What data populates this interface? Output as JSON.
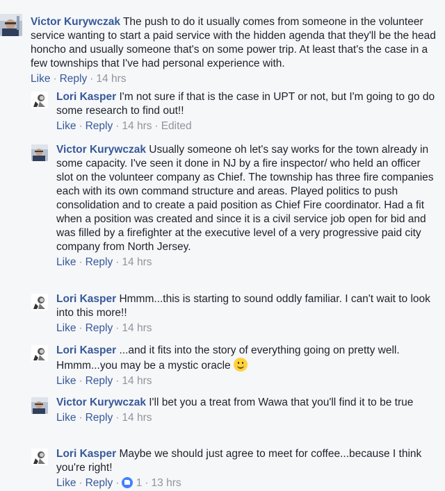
{
  "comments": {
    "top": {
      "author": "Victor Kurywczak",
      "text": "The push to do it usually comes from someone in the volunteer service wanting to start a paid service with the hidden agenda that they'll be the head honcho and usually someone that's on some power trip. At least that's the case in a few townships that I've had personal experience with.",
      "like": "Like",
      "reply": "Reply",
      "time": "14 hrs"
    },
    "replies": [
      {
        "author": "Lori Kasper",
        "text": "I'm not sure if that is the case in UPT or not, but I'm going to go do some research to find out!!",
        "like": "Like",
        "reply": "Reply",
        "time": "14 hrs",
        "edited": "Edited"
      },
      {
        "author": "Victor Kurywczak",
        "text": "Usually someone oh let's say works for the town already in some capacity. I've seen it done in NJ by a fire inspector/ who held an officer slot on the volunteer company as Chief. The township has three fire companies each with its own command structure and areas. Played politics to push consolidation and to create a paid position as Chief Fire coordinator. Had a fit when a position was created and since it is a civil service job open for bid and was filled by a firefighter at the executive level of a very progressive paid city company from North Jersey.",
        "like": "Like",
        "reply": "Reply",
        "time": "14 hrs"
      },
      {
        "author": "Lori Kasper",
        "text": "Hmmm...this is starting to sound oddly familiar. I can't wait to look into this more!!",
        "like": "Like",
        "reply": "Reply",
        "time": "14 hrs"
      },
      {
        "author": "Lori Kasper",
        "text": "...and it fits into the story of everything going on pretty well. Hmmm...you may be a mystic oracle",
        "like": "Like",
        "reply": "Reply",
        "time": "14 hrs"
      },
      {
        "author": "Victor Kurywczak",
        "text": "I'll bet you a treat from Wawa that you'll find it to be true",
        "like": "Like",
        "reply": "Reply",
        "time": "14 hrs"
      },
      {
        "author": "Lori Kasper",
        "text": "Maybe we should just agree to meet for coffee...because I think you're right!",
        "like": "Like",
        "reply": "Reply",
        "reactions": "1",
        "time": "13 hrs"
      }
    ]
  },
  "icons": {
    "like_reaction": "thumbs-up-icon",
    "smiley": "smiley-emoji-icon"
  },
  "colors": {
    "name": "#365899",
    "meta": "#90949c",
    "like_badge": "#4080ff"
  }
}
